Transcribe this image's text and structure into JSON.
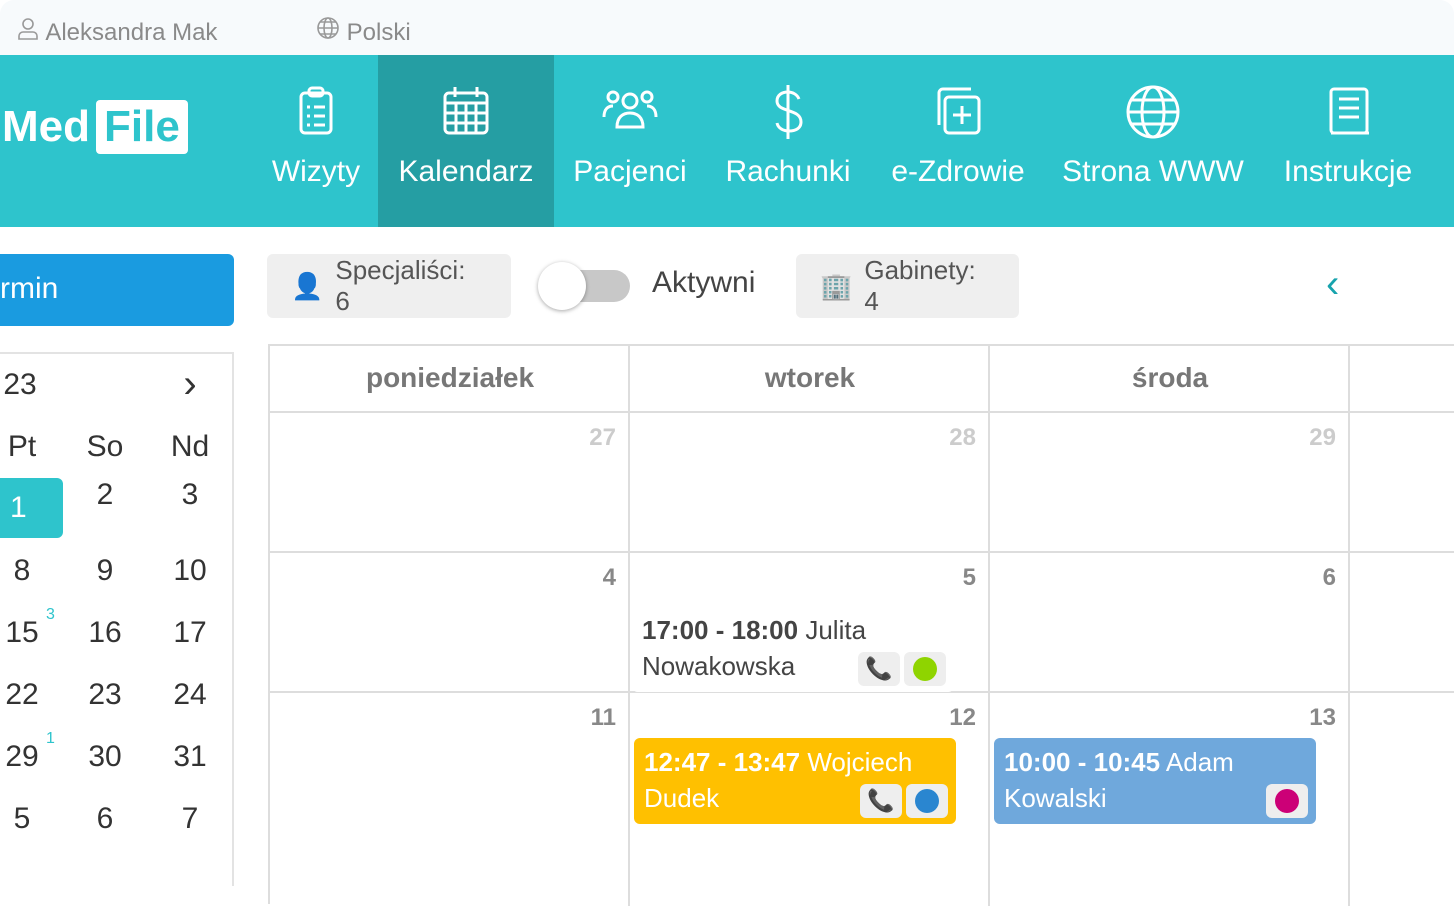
{
  "topbar": {
    "user": "Aleksandra Mak",
    "language": "Polski"
  },
  "logo": {
    "text1": "Med",
    "text2": "File"
  },
  "nav": [
    {
      "label": "Wizyty",
      "icon": "clipboard-icon"
    },
    {
      "label": "Kalendarz",
      "icon": "calendar-icon",
      "active": true
    },
    {
      "label": "Pacjenci",
      "icon": "users-icon"
    },
    {
      "label": "Rachunki",
      "icon": "dollar-icon"
    },
    {
      "label": "e-Zdrowie",
      "icon": "medical-copy-icon"
    },
    {
      "label": "Strona WWW",
      "icon": "globe-icon"
    },
    {
      "label": "Instrukcje",
      "icon": "book-icon"
    }
  ],
  "toolbar": {
    "new_term": "rmin",
    "specialists": "Specjaliści: 6",
    "active_toggle": "Aktywni",
    "active_on": false,
    "rooms": "Gabinety: 4",
    "prev": "‹"
  },
  "mini_calendar": {
    "month_fragment": "23",
    "next": "›",
    "weekdays": [
      "Pt",
      "So",
      "Nd"
    ],
    "rows": [
      [
        "1",
        "2",
        "3"
      ],
      [
        "8",
        "9",
        "10"
      ],
      [
        "15",
        "16",
        "17"
      ],
      [
        "22",
        "23",
        "24"
      ],
      [
        "29",
        "30",
        "31"
      ],
      [
        "5",
        "6",
        "7"
      ]
    ],
    "selected": "1",
    "badges": {
      "15": "3",
      "29": "1"
    }
  },
  "calendar": {
    "days": [
      "poniedziałek",
      "wtorek",
      "środa"
    ],
    "weeks": [
      [
        "27",
        "28",
        "29"
      ],
      [
        "4",
        "5",
        "6"
      ],
      [
        "11",
        "12",
        "13"
      ]
    ],
    "events": [
      {
        "time": "17:00 - 18:00",
        "name": "Julita Nowakowska",
        "bg": "#ffffff",
        "dot": "#8fd400",
        "phone": true
      },
      {
        "time": "12:47 - 13:47",
        "name": "Wojciech Dudek",
        "bg": "#ffc000",
        "dot": "#2a86d0",
        "phone": true
      },
      {
        "time": "10:00 - 10:45",
        "name": "Adam Kowalski",
        "bg": "#6fa8dc",
        "dot": "#cc0077",
        "phone": false
      }
    ]
  },
  "colors": {
    "nav": "#2ec4cc",
    "nav_active": "#259ea3",
    "button": "#1a9be0"
  }
}
